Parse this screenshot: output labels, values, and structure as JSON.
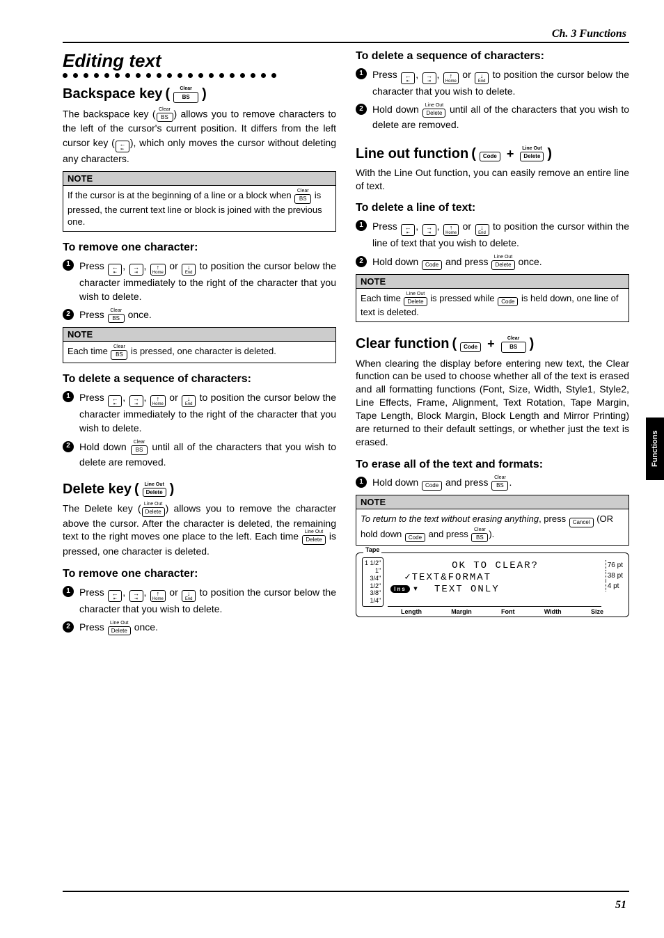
{
  "chapter": "Ch. 3 Functions",
  "side_tab": "Functions",
  "page_number": "51",
  "section_title": "Editing text",
  "keys": {
    "bs": {
      "super": "Clear",
      "label": "BS"
    },
    "delete": {
      "super": "Line Out",
      "label": "Delete"
    },
    "code": {
      "label": "Code"
    },
    "cancel": {
      "label": "Cancel"
    },
    "left": {
      "main": "←",
      "sub": "⇤"
    },
    "right": {
      "main": "→",
      "sub": "⇥"
    },
    "home": {
      "main": "↑",
      "sub": "Home"
    },
    "end": {
      "main": "↓",
      "sub": "End"
    }
  },
  "headings": {
    "backspace": "Backspace key",
    "delete": "Delete key",
    "lineout": "Line out function",
    "clear": "Clear function"
  },
  "text": {
    "backspace_intro_a": "The backspace key (",
    "backspace_intro_b": ") allows you to remove characters to the left of the cursor's current position. It differs from the left cursor key (",
    "backspace_intro_c": "), which only moves the cursor without deleting any characters.",
    "note_label": "NOTE",
    "bs_note_a": "If the cursor is at the beginning of a line or a block when ",
    "bs_note_b": " is pressed, the current text line or block is joined with the previous one.",
    "remove_one": "To remove one character:",
    "press": "Press ",
    "or": " or ",
    "comma": ", ",
    "pos_below_immediate": " to position the cursor below the character immediately to the right of the character that you wish to delete.",
    "once": " once.",
    "each_time": "Each time ",
    "bs_each_b": " is pressed, one character is deleted.",
    "del_seq": "To delete a sequence of characters:",
    "hold_down": "Hold down ",
    "bs_hold_b": " until all of the characters that you wish to delete are removed.",
    "delete_intro_a": "The Delete key (",
    "delete_intro_b": ") allows you to remove the character above the cursor. After the character is deleted, the remaining text to the right moves one place to the left. Each time ",
    "delete_intro_c": " is pressed, one character is deleted.",
    "pos_below_wish": " to position the cursor below the character that you wish to delete.",
    "del_hold_b": " until all of the characters that you wish to delete are removed.",
    "lineout_intro": "With the Line Out function, you can easily remove an entire line of text.",
    "del_line": "To delete a line of text:",
    "pos_within_line": " to position the cursor within the line of text that you wish to delete.",
    "and_press": " and press ",
    "lineout_note_a": "Each time ",
    "lineout_note_b": " is pressed while ",
    "lineout_note_c": " is held down, one line of text is deleted.",
    "clear_intro": "When clearing the display before entering new text, the Clear function can be used to choose whether all of the text is erased and all formatting functions (Font, Size, Width, Style1, Style2, Line Effects, Frame, Alignment, Text Rotation, Tape Margin, Tape Length, Block Margin, Block Length and Mirror Printing) are returned to their default settings, or whether just the text is erased.",
    "erase_all": "To erase all of the text and formats:",
    "clear_step_end": ".",
    "clear_note_a": "To return to the text without erasing anything",
    "clear_note_press": ", press ",
    "clear_note_b": " (OR hold down ",
    "clear_note_c": " and press ",
    "clear_note_d": ")."
  },
  "lcd": {
    "tape_label": "Tape",
    "sizes": [
      "1 1/2\"",
      "1\"",
      "3/4\"",
      "1/2\"",
      "3/8\"",
      "1/4\""
    ],
    "line1": "OK TO CLEAR?",
    "line2": "✓TEXT&FORMAT",
    "line3": "TEXT ONLY",
    "ins": "Ins",
    "pts": [
      "76 pt",
      "38 pt",
      "4 pt"
    ],
    "bottom": [
      "Length",
      "Margin",
      "Font",
      "Width",
      "Size"
    ]
  }
}
